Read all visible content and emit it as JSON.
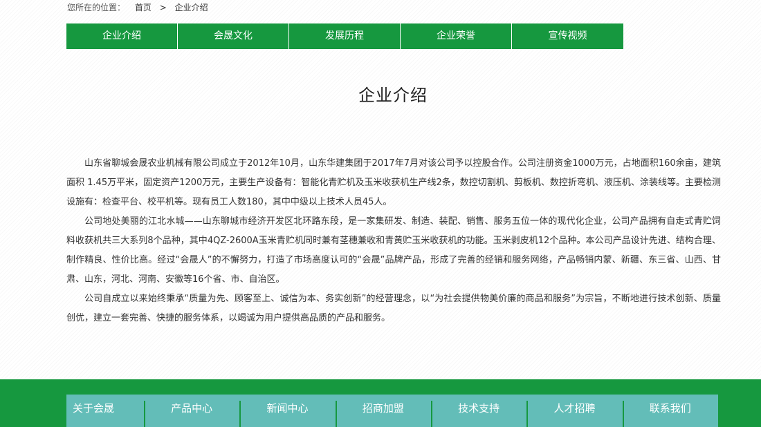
{
  "breadcrumb": {
    "prefix": "您所在的位置：",
    "home": "首页",
    "separator": ">",
    "current": "企业介绍"
  },
  "tabs": [
    {
      "label": "企业介绍"
    },
    {
      "label": "会晟文化"
    },
    {
      "label": "发展历程"
    },
    {
      "label": "企业荣誉"
    },
    {
      "label": "宣传视频"
    }
  ],
  "page": {
    "title": "企业介绍"
  },
  "content": {
    "paragraphs": [
      "山东省聊城会晟农业机械有限公司成立于2012年10月，山东华建集团于2017年7月对该公司予以控股合作。公司注册资金1000万元，占地面积160余亩，建筑面积 1.45万平米，固定资产1200万元，主要生产设备有：智能化青贮机及玉米收获机生产线2条，数控切割机、剪板机、数控折弯机、液压机、涂装线等。主要检测设施有：检查平台、校平机等。现有员工人数180，其中中级以上技术人员45人。",
      "公司地处美丽的江北水城——山东聊城市经济开发区北环路东段，是一家集研发、制造、装配、销售、服务五位一体的现代化企业，公司产品拥有自走式青贮饲料收获机共三大系列8个品种，其中4QZ-2600A玉米青贮机同时兼有茎穗兼收和青黄贮玉米收获机的功能。玉米剥皮机12个品种。本公司产品设计先进、结构合理、制作精良、性价比高。经过“会晟人”的不懈努力，打造了市场高度认可的“会晟”品牌产品，形成了完善的经销和服务网络，产品畅销内蒙、新疆、东三省、山西、甘肃、山东，河北、河南、安徽等16个省、市、自治区。",
      "公司自成立以来始终秉承“质量为先、顾客至上、诚信为本、务实创新”的经营理念，以“为社会提供物美价廉的商品和服务”为宗旨，不断地进行技术创新、质量创优，建立一套完善、快捷的服务体系，以竭诚为用户提供高品质的产品和服务。"
    ]
  },
  "footer": {
    "nav": [
      {
        "label": "关于会晟"
      },
      {
        "label": "产品中心"
      },
      {
        "label": "新闻中心"
      },
      {
        "label": "招商加盟"
      },
      {
        "label": "技术支持"
      },
      {
        "label": "人才招聘"
      },
      {
        "label": "联系我们"
      }
    ]
  },
  "colors": {
    "primary_green": "#16983f",
    "footer_teal": "#63bdb8"
  }
}
